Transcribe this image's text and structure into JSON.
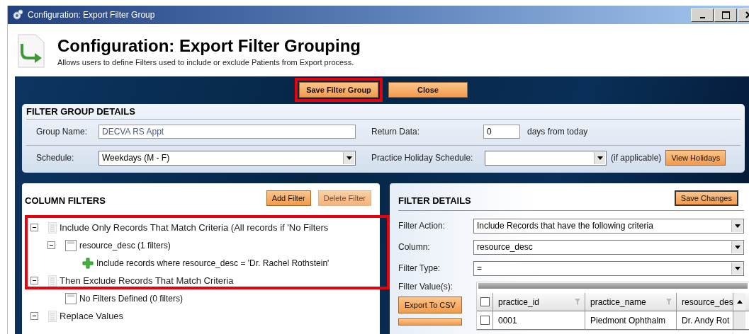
{
  "window": {
    "title": "Configuration: Export Filter Group"
  },
  "header": {
    "title": "Configuration:  Export Filter Grouping",
    "subtitle": "Allows users to define Filters used to include or exclude Patients from Export process."
  },
  "toolbar": [
    {
      "label": "Save Filter Group"
    },
    {
      "label": "Close"
    }
  ],
  "filter_group_details": {
    "title": "FILTER GROUP DETAILS",
    "group_name": {
      "label": "Group Name:",
      "value": "DECVA RS Appt"
    },
    "return_data": {
      "label": "Return Data:",
      "value": "0",
      "suffix": "days from today"
    },
    "schedule": {
      "label": "Schedule:",
      "value": "Weekdays (M - F)"
    },
    "holiday_schedule": {
      "label": "Practice Holiday Schedule:",
      "note": "(if applicable)"
    },
    "view_holidays": "View Holidays"
  },
  "column_filters": {
    "title": "COLUMN FILTERS",
    "buttons": [
      {
        "label": "Add Filter",
        "disabled": false
      },
      {
        "label": "Delete Filter",
        "disabled": true
      }
    ],
    "tree": [
      {
        "kind": "section",
        "label": "Include Only Records That Match Criteria (All records if 'No Filters",
        "expanded": true,
        "children": [
          {
            "kind": "column",
            "label": "resource_desc (1 filters)",
            "expanded": true,
            "children": [
              {
                "kind": "include",
                "label": "Include records where resource_desc = 'Dr. Rachel Rothstein'"
              }
            ]
          }
        ]
      },
      {
        "kind": "section",
        "label": "Then Exclude Records That Match Criteria",
        "expanded": true,
        "children": [
          {
            "kind": "column",
            "label": "No Filters Defined (0 filters)"
          }
        ]
      },
      {
        "kind": "section",
        "label": "Replace Values",
        "expanded": true
      }
    ]
  },
  "filter_details": {
    "title": "FILTER DETAILS",
    "save_button": "Save Changes",
    "fields": [
      {
        "label": "Filter Action:",
        "value": "Include Records that have the following criteria"
      },
      {
        "label": "Column:",
        "value": "resource_desc"
      },
      {
        "label": "Filter Type:",
        "value": "="
      }
    ],
    "values_label": "Filter Value(s):",
    "export_button": "Export To CSV",
    "grid": {
      "header_checked": false,
      "columns": [
        "practice_id",
        "practice_name",
        "resource_des"
      ],
      "rows": [
        {
          "checked": false,
          "cells": [
            "0001",
            "Piedmont Ophthalm",
            "Dr. Andy Rot"
          ]
        }
      ]
    }
  }
}
